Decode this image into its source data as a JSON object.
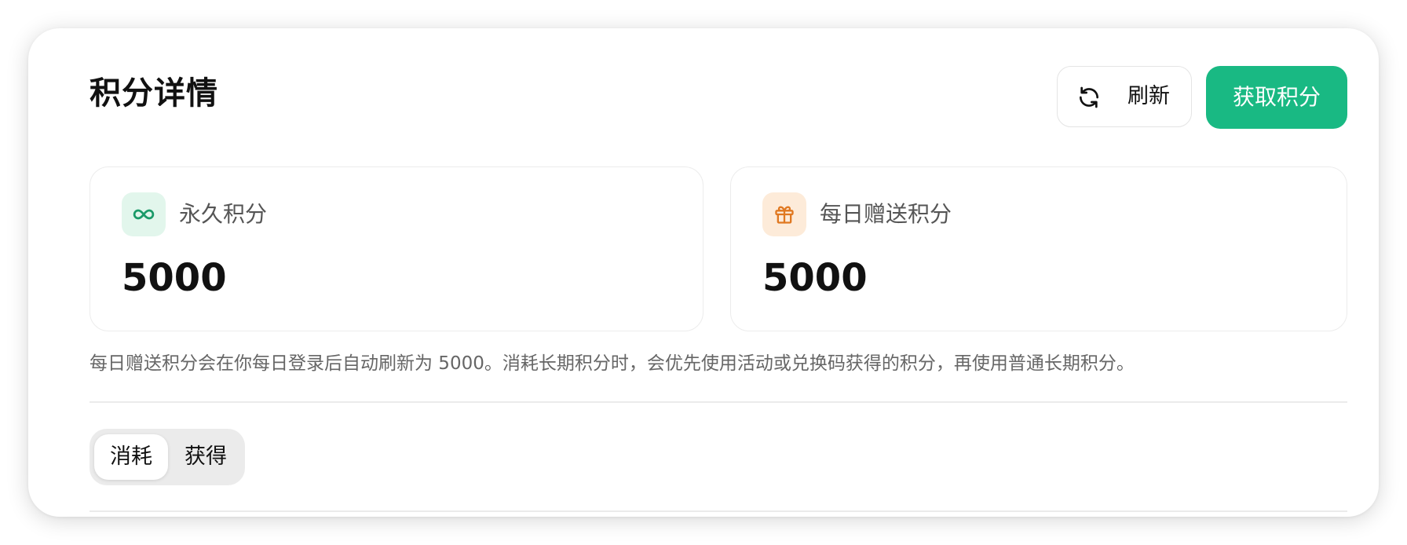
{
  "header": {
    "title": "积分详情",
    "refresh_label": "刷新",
    "refresh_icon": "refresh-icon",
    "earn_label": "获取积分"
  },
  "cards": [
    {
      "label": "永久积分",
      "value": "5000",
      "icon": "infinity-icon",
      "icon_color": "#1a9a68"
    },
    {
      "label": "每日赠送积分",
      "value": "5000",
      "icon": "gift-icon",
      "icon_color": "#e07820"
    }
  ],
  "note": "每日赠送积分会在你每日登录后自动刷新为 5000。消耗长期积分时，会优先使用活动或兑换码获得的积分，再使用普通长期积分。",
  "tabs": [
    {
      "label": "消耗",
      "active": true
    },
    {
      "label": "获得",
      "active": false
    }
  ],
  "colors": {
    "accent": "#19b983"
  }
}
